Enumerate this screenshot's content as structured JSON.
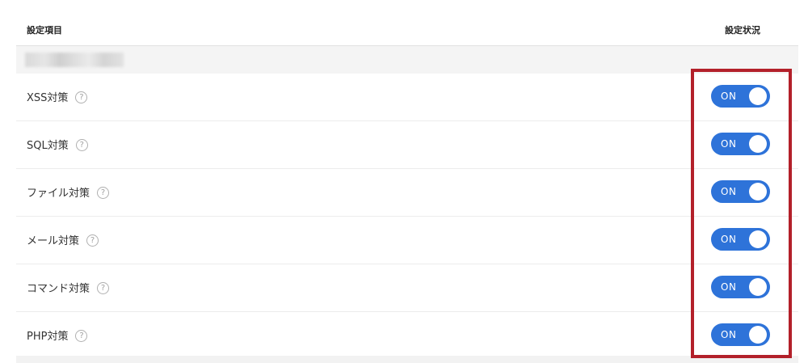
{
  "header": {
    "item_column": "設定項目",
    "status_column": "設定状況"
  },
  "group": {
    "label": ""
  },
  "settings": [
    {
      "label": "XSS対策",
      "state": "ON",
      "help": "?"
    },
    {
      "label": "SQL対策",
      "state": "ON",
      "help": "?"
    },
    {
      "label": "ファイル対策",
      "state": "ON",
      "help": "?"
    },
    {
      "label": "メール対策",
      "state": "ON",
      "help": "?"
    },
    {
      "label": "コマンド対策",
      "state": "ON",
      "help": "?"
    },
    {
      "label": "PHP対策",
      "state": "ON",
      "help": "?"
    }
  ],
  "colors": {
    "toggle_on": "#2e73d9",
    "highlight": "#b3202a"
  },
  "icons": {
    "help": "question-circle-icon"
  }
}
